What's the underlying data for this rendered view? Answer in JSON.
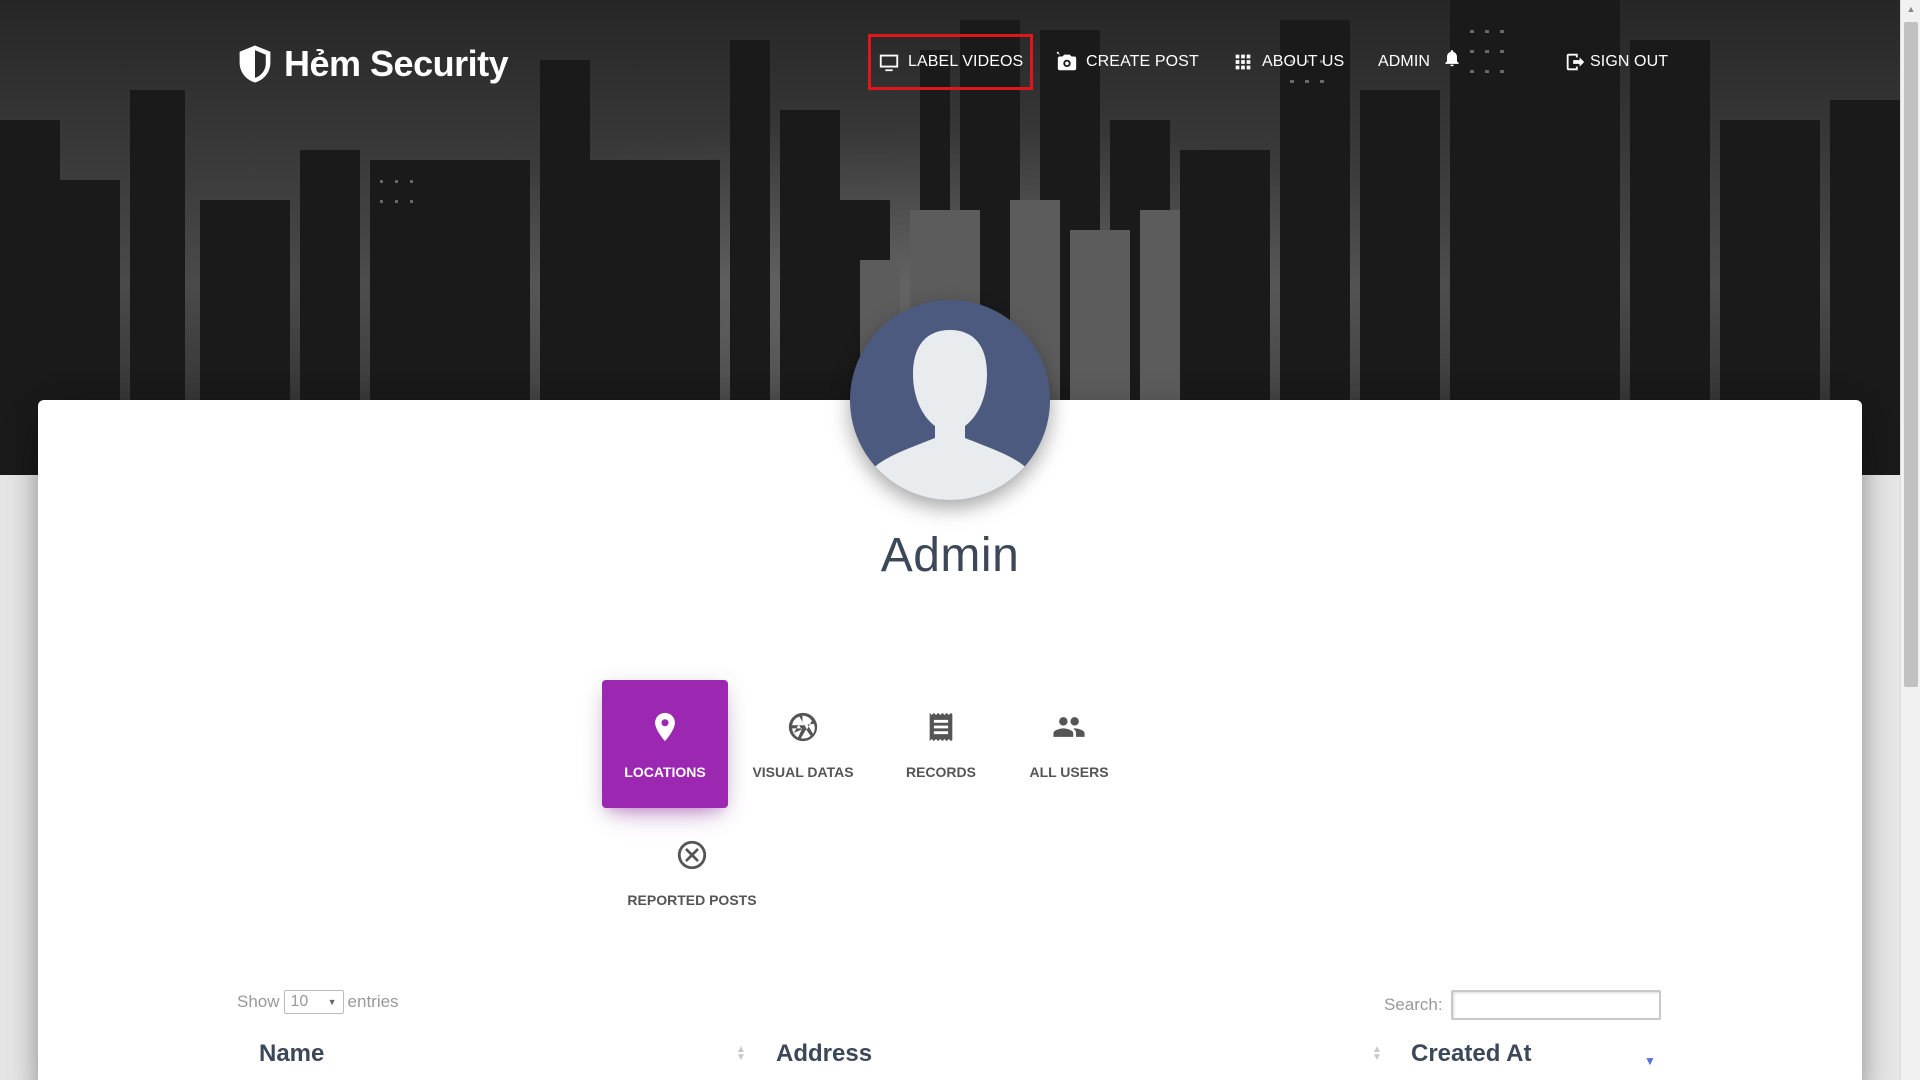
{
  "brand": {
    "name": "Hẻm Security",
    "icon": "shield-icon"
  },
  "nav": {
    "label_videos": "LABEL VIDEOS",
    "create_post": "CREATE POST",
    "about_us": "ABOUT US",
    "admin": "ADMIN",
    "sign_out": "SIGN OUT"
  },
  "profile": {
    "name": "Admin"
  },
  "tabs": [
    {
      "label": "LOCATIONS",
      "icon": "location-pin-icon",
      "active": true
    },
    {
      "label": "VISUAL DATAS",
      "icon": "camera-aperture-icon",
      "active": false
    },
    {
      "label": "RECORDS",
      "icon": "receipt-icon",
      "active": false
    },
    {
      "label": "ALL USERS",
      "icon": "users-icon",
      "active": false
    },
    {
      "label": "REPORTED POSTS",
      "icon": "cancel-circle-icon",
      "active": false
    }
  ],
  "table": {
    "show_label": "Show",
    "entries_value": "10",
    "entries_label": "entries",
    "search_label": "Search:",
    "columns": [
      "Name",
      "Address",
      "Created At"
    ]
  },
  "colors": {
    "accent": "#9c27b0",
    "highlight": "#e0161b",
    "avatar_bg": "#4d5a7f"
  }
}
